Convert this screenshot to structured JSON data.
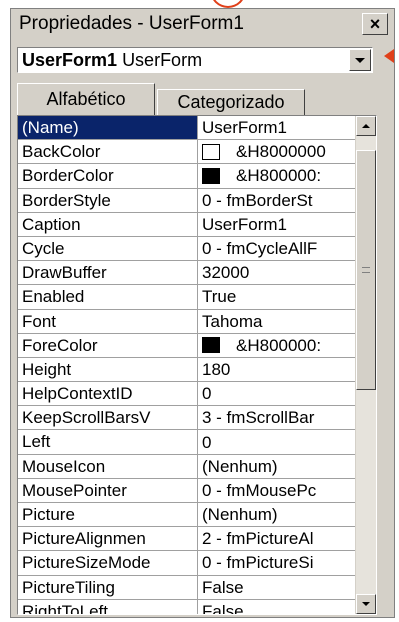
{
  "window": {
    "title": "Propriedades - UserForm1",
    "close_label": "×"
  },
  "object_selector": {
    "name": "UserForm1",
    "type": "UserForm"
  },
  "tabs": [
    {
      "label": "Alfabético",
      "active": true
    },
    {
      "label": "Categorizado",
      "active": false
    }
  ],
  "properties": [
    {
      "name": "(Name)",
      "value": "UserForm1",
      "selected": true
    },
    {
      "name": "BackColor",
      "value": "&H8000000",
      "swatch": "#ffffff"
    },
    {
      "name": "BorderColor",
      "value": "&H800000:",
      "swatch": "#000000"
    },
    {
      "name": "BorderStyle",
      "value": "0 - fmBorderSt"
    },
    {
      "name": "Caption",
      "value": "UserForm1"
    },
    {
      "name": "Cycle",
      "value": "0 - fmCycleAllF"
    },
    {
      "name": "DrawBuffer",
      "value": "32000"
    },
    {
      "name": "Enabled",
      "value": "True"
    },
    {
      "name": "Font",
      "value": "Tahoma"
    },
    {
      "name": "ForeColor",
      "value": "&H800000:",
      "swatch": "#000000"
    },
    {
      "name": "Height",
      "value": "180"
    },
    {
      "name": "HelpContextID",
      "value": "0"
    },
    {
      "name": "KeepScrollBarsV",
      "value": "3 - fmScrollBar"
    },
    {
      "name": "Left",
      "value": "0"
    },
    {
      "name": "MouseIcon",
      "value": "(Nenhum)"
    },
    {
      "name": "MousePointer",
      "value": "0 - fmMousePc"
    },
    {
      "name": "Picture",
      "value": "(Nenhum)"
    },
    {
      "name": "PictureAlignmen",
      "value": "2 - fmPictureAl"
    },
    {
      "name": "PictureSizeMode",
      "value": "0 - fmPictureSi"
    },
    {
      "name": "PictureTiling",
      "value": "False"
    },
    {
      "name": "RightToLeft",
      "value": "False"
    }
  ],
  "colors": {
    "selected_bg": "#0a246a",
    "panel_bg": "#d4d0c8",
    "accent_red": "#e0401a"
  }
}
